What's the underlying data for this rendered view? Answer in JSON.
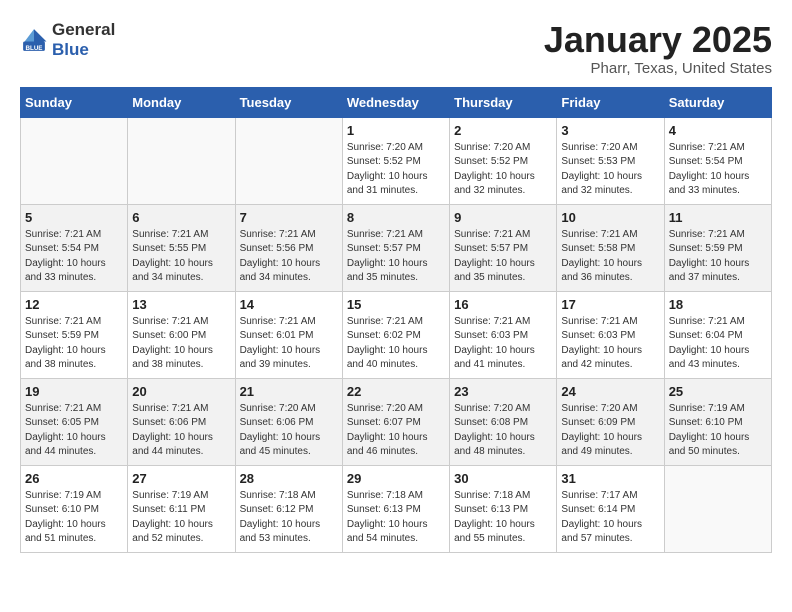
{
  "header": {
    "logo_general": "General",
    "logo_blue": "Blue",
    "title": "January 2025",
    "subtitle": "Pharr, Texas, United States"
  },
  "weekdays": [
    "Sunday",
    "Monday",
    "Tuesday",
    "Wednesday",
    "Thursday",
    "Friday",
    "Saturday"
  ],
  "weeks": [
    [
      {
        "day": "",
        "sunrise": "",
        "sunset": "",
        "daylight": ""
      },
      {
        "day": "",
        "sunrise": "",
        "sunset": "",
        "daylight": ""
      },
      {
        "day": "",
        "sunrise": "",
        "sunset": "",
        "daylight": ""
      },
      {
        "day": "1",
        "sunrise": "Sunrise: 7:20 AM",
        "sunset": "Sunset: 5:52 PM",
        "daylight": "Daylight: 10 hours and 31 minutes."
      },
      {
        "day": "2",
        "sunrise": "Sunrise: 7:20 AM",
        "sunset": "Sunset: 5:52 PM",
        "daylight": "Daylight: 10 hours and 32 minutes."
      },
      {
        "day": "3",
        "sunrise": "Sunrise: 7:20 AM",
        "sunset": "Sunset: 5:53 PM",
        "daylight": "Daylight: 10 hours and 32 minutes."
      },
      {
        "day": "4",
        "sunrise": "Sunrise: 7:21 AM",
        "sunset": "Sunset: 5:54 PM",
        "daylight": "Daylight: 10 hours and 33 minutes."
      }
    ],
    [
      {
        "day": "5",
        "sunrise": "Sunrise: 7:21 AM",
        "sunset": "Sunset: 5:54 PM",
        "daylight": "Daylight: 10 hours and 33 minutes."
      },
      {
        "day": "6",
        "sunrise": "Sunrise: 7:21 AM",
        "sunset": "Sunset: 5:55 PM",
        "daylight": "Daylight: 10 hours and 34 minutes."
      },
      {
        "day": "7",
        "sunrise": "Sunrise: 7:21 AM",
        "sunset": "Sunset: 5:56 PM",
        "daylight": "Daylight: 10 hours and 34 minutes."
      },
      {
        "day": "8",
        "sunrise": "Sunrise: 7:21 AM",
        "sunset": "Sunset: 5:57 PM",
        "daylight": "Daylight: 10 hours and 35 minutes."
      },
      {
        "day": "9",
        "sunrise": "Sunrise: 7:21 AM",
        "sunset": "Sunset: 5:57 PM",
        "daylight": "Daylight: 10 hours and 35 minutes."
      },
      {
        "day": "10",
        "sunrise": "Sunrise: 7:21 AM",
        "sunset": "Sunset: 5:58 PM",
        "daylight": "Daylight: 10 hours and 36 minutes."
      },
      {
        "day": "11",
        "sunrise": "Sunrise: 7:21 AM",
        "sunset": "Sunset: 5:59 PM",
        "daylight": "Daylight: 10 hours and 37 minutes."
      }
    ],
    [
      {
        "day": "12",
        "sunrise": "Sunrise: 7:21 AM",
        "sunset": "Sunset: 5:59 PM",
        "daylight": "Daylight: 10 hours and 38 minutes."
      },
      {
        "day": "13",
        "sunrise": "Sunrise: 7:21 AM",
        "sunset": "Sunset: 6:00 PM",
        "daylight": "Daylight: 10 hours and 38 minutes."
      },
      {
        "day": "14",
        "sunrise": "Sunrise: 7:21 AM",
        "sunset": "Sunset: 6:01 PM",
        "daylight": "Daylight: 10 hours and 39 minutes."
      },
      {
        "day": "15",
        "sunrise": "Sunrise: 7:21 AM",
        "sunset": "Sunset: 6:02 PM",
        "daylight": "Daylight: 10 hours and 40 minutes."
      },
      {
        "day": "16",
        "sunrise": "Sunrise: 7:21 AM",
        "sunset": "Sunset: 6:03 PM",
        "daylight": "Daylight: 10 hours and 41 minutes."
      },
      {
        "day": "17",
        "sunrise": "Sunrise: 7:21 AM",
        "sunset": "Sunset: 6:03 PM",
        "daylight": "Daylight: 10 hours and 42 minutes."
      },
      {
        "day": "18",
        "sunrise": "Sunrise: 7:21 AM",
        "sunset": "Sunset: 6:04 PM",
        "daylight": "Daylight: 10 hours and 43 minutes."
      }
    ],
    [
      {
        "day": "19",
        "sunrise": "Sunrise: 7:21 AM",
        "sunset": "Sunset: 6:05 PM",
        "daylight": "Daylight: 10 hours and 44 minutes."
      },
      {
        "day": "20",
        "sunrise": "Sunrise: 7:21 AM",
        "sunset": "Sunset: 6:06 PM",
        "daylight": "Daylight: 10 hours and 44 minutes."
      },
      {
        "day": "21",
        "sunrise": "Sunrise: 7:20 AM",
        "sunset": "Sunset: 6:06 PM",
        "daylight": "Daylight: 10 hours and 45 minutes."
      },
      {
        "day": "22",
        "sunrise": "Sunrise: 7:20 AM",
        "sunset": "Sunset: 6:07 PM",
        "daylight": "Daylight: 10 hours and 46 minutes."
      },
      {
        "day": "23",
        "sunrise": "Sunrise: 7:20 AM",
        "sunset": "Sunset: 6:08 PM",
        "daylight": "Daylight: 10 hours and 48 minutes."
      },
      {
        "day": "24",
        "sunrise": "Sunrise: 7:20 AM",
        "sunset": "Sunset: 6:09 PM",
        "daylight": "Daylight: 10 hours and 49 minutes."
      },
      {
        "day": "25",
        "sunrise": "Sunrise: 7:19 AM",
        "sunset": "Sunset: 6:10 PM",
        "daylight": "Daylight: 10 hours and 50 minutes."
      }
    ],
    [
      {
        "day": "26",
        "sunrise": "Sunrise: 7:19 AM",
        "sunset": "Sunset: 6:10 PM",
        "daylight": "Daylight: 10 hours and 51 minutes."
      },
      {
        "day": "27",
        "sunrise": "Sunrise: 7:19 AM",
        "sunset": "Sunset: 6:11 PM",
        "daylight": "Daylight: 10 hours and 52 minutes."
      },
      {
        "day": "28",
        "sunrise": "Sunrise: 7:18 AM",
        "sunset": "Sunset: 6:12 PM",
        "daylight": "Daylight: 10 hours and 53 minutes."
      },
      {
        "day": "29",
        "sunrise": "Sunrise: 7:18 AM",
        "sunset": "Sunset: 6:13 PM",
        "daylight": "Daylight: 10 hours and 54 minutes."
      },
      {
        "day": "30",
        "sunrise": "Sunrise: 7:18 AM",
        "sunset": "Sunset: 6:13 PM",
        "daylight": "Daylight: 10 hours and 55 minutes."
      },
      {
        "day": "31",
        "sunrise": "Sunrise: 7:17 AM",
        "sunset": "Sunset: 6:14 PM",
        "daylight": "Daylight: 10 hours and 57 minutes."
      },
      {
        "day": "",
        "sunrise": "",
        "sunset": "",
        "daylight": ""
      }
    ]
  ]
}
